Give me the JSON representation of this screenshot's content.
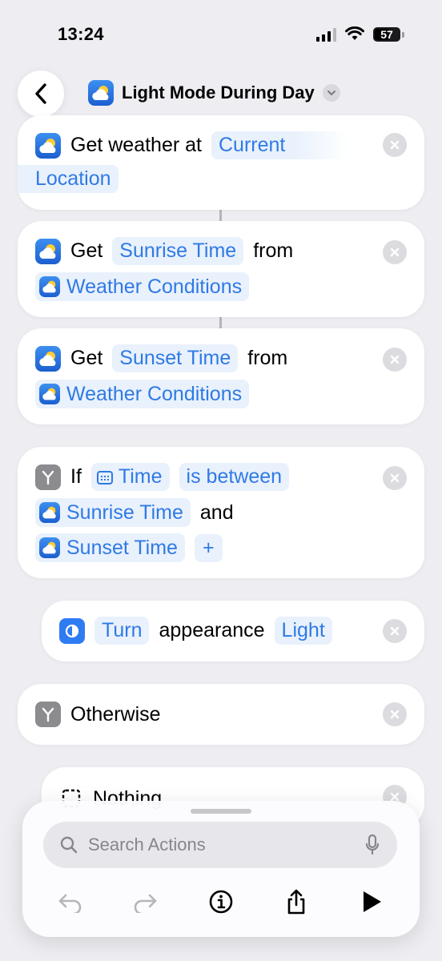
{
  "status_bar": {
    "time": "13:24",
    "battery": "57"
  },
  "header": {
    "title": "Light Mode During Day",
    "back_icon": "chevron-left-icon",
    "title_icon": "weather-icon",
    "menu_icon": "chevron-down-icon"
  },
  "actions": {
    "get_weather": {
      "text": "Get weather at",
      "location_line1": "Current",
      "location_line2": "Location"
    },
    "get_sunrise": {
      "get": "Get",
      "value": "Sunrise Time",
      "from": "from",
      "source": "Weather Conditions"
    },
    "get_sunset": {
      "get": "Get",
      "value": "Sunset Time",
      "from": "from",
      "source": "Weather Conditions"
    },
    "if_block": {
      "if": "If",
      "variable": "Time",
      "condition": "is between",
      "start": "Sunrise Time",
      "and": "and",
      "end": "Sunset Time",
      "add": "+"
    },
    "turn_appearance": {
      "turn": "Turn",
      "text": "appearance",
      "mode": "Light"
    },
    "otherwise": {
      "text": "Otherwise"
    },
    "nothing": {
      "text": "Nothing"
    }
  },
  "bottom_sheet": {
    "search_placeholder": "Search Actions",
    "toolbar_icons": [
      "undo-icon",
      "redo-icon",
      "info-icon",
      "share-icon",
      "play-icon"
    ]
  },
  "colors": {
    "accent": "#2f7ae5",
    "token_bg": "#e9f1fc",
    "background": "#eeeef2"
  }
}
